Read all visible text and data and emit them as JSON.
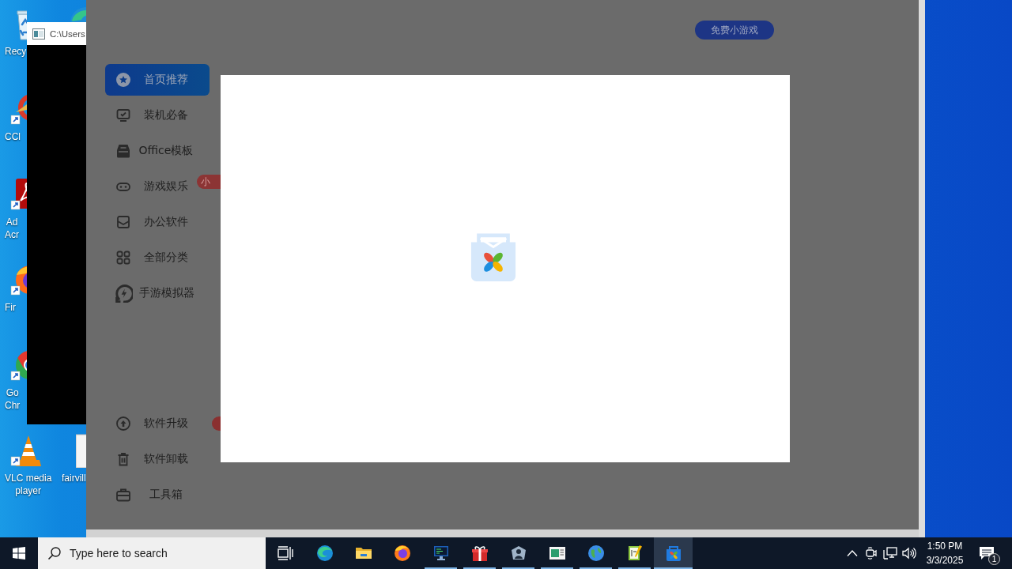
{
  "desktop": {
    "columns": [
      [
        {
          "kind": "recycle",
          "lines": [
            "Recy"
          ]
        },
        {
          "kind": "cleaner",
          "lines": [
            "CCl"
          ]
        },
        {
          "kind": "reader",
          "lines": [
            "Ad",
            "Acr"
          ]
        },
        {
          "kind": "firefox",
          "lines": [
            "Fir"
          ]
        },
        {
          "kind": "chrome",
          "lines": [
            "Go",
            "Chr"
          ]
        },
        {
          "kind": "vlc",
          "lines": [
            "VLC media",
            "player"
          ]
        }
      ],
      [
        {
          "kind": "edge"
        },
        {
          "kind": "file",
          "lines": [
            "fairvill"
          ]
        }
      ]
    ]
  },
  "console_window": {
    "title": "C:\\Users"
  },
  "app": {
    "sidebar": {
      "items": [
        {
          "kind": "star",
          "label": "首页推荐",
          "selected": true
        },
        {
          "kind": "monitor",
          "label": "装机必备",
          "selected": false
        },
        {
          "kind": "drawer",
          "label": "Office模板",
          "selected": false
        },
        {
          "kind": "gamepad",
          "label": "游戏娱乐",
          "selected": false,
          "badge": "小"
        },
        {
          "kind": "envelope",
          "label": "办公软件",
          "selected": false
        },
        {
          "kind": "grid",
          "label": "全部分类",
          "selected": false
        },
        {
          "kind": "emulator",
          "label": "手游模拟器",
          "selected": false
        }
      ],
      "footer_items": [
        {
          "kind": "upgrade",
          "label": "软件升级",
          "selected": false,
          "has_badge": true
        },
        {
          "kind": "trash",
          "label": "软件卸载",
          "selected": false,
          "has_badge": false
        },
        {
          "kind": "toolbox",
          "label": "工具箱",
          "selected": false,
          "has_badge": false
        }
      ]
    },
    "top_button": "免费小游戏"
  },
  "taskbar": {
    "search": {
      "placeholder": "Type here to search"
    },
    "apps": [
      {
        "kind": "edge",
        "running": false,
        "selected": false
      },
      {
        "kind": "folder",
        "running": false,
        "selected": false
      },
      {
        "kind": "firefox",
        "running": false,
        "selected": false
      },
      {
        "kind": "terminal",
        "running": true,
        "selected": false
      },
      {
        "kind": "gift",
        "running": true,
        "selected": false
      },
      {
        "kind": "shield",
        "running": true,
        "selected": false
      },
      {
        "kind": "window",
        "running": true,
        "selected": false
      },
      {
        "kind": "globe",
        "running": true,
        "selected": false
      },
      {
        "kind": "notepad",
        "running": true,
        "selected": false
      },
      {
        "kind": "store",
        "running": true,
        "selected": true
      }
    ],
    "tray": {
      "time": "1:50 PM",
      "date": "3/3/2025",
      "notifications": "1"
    }
  }
}
